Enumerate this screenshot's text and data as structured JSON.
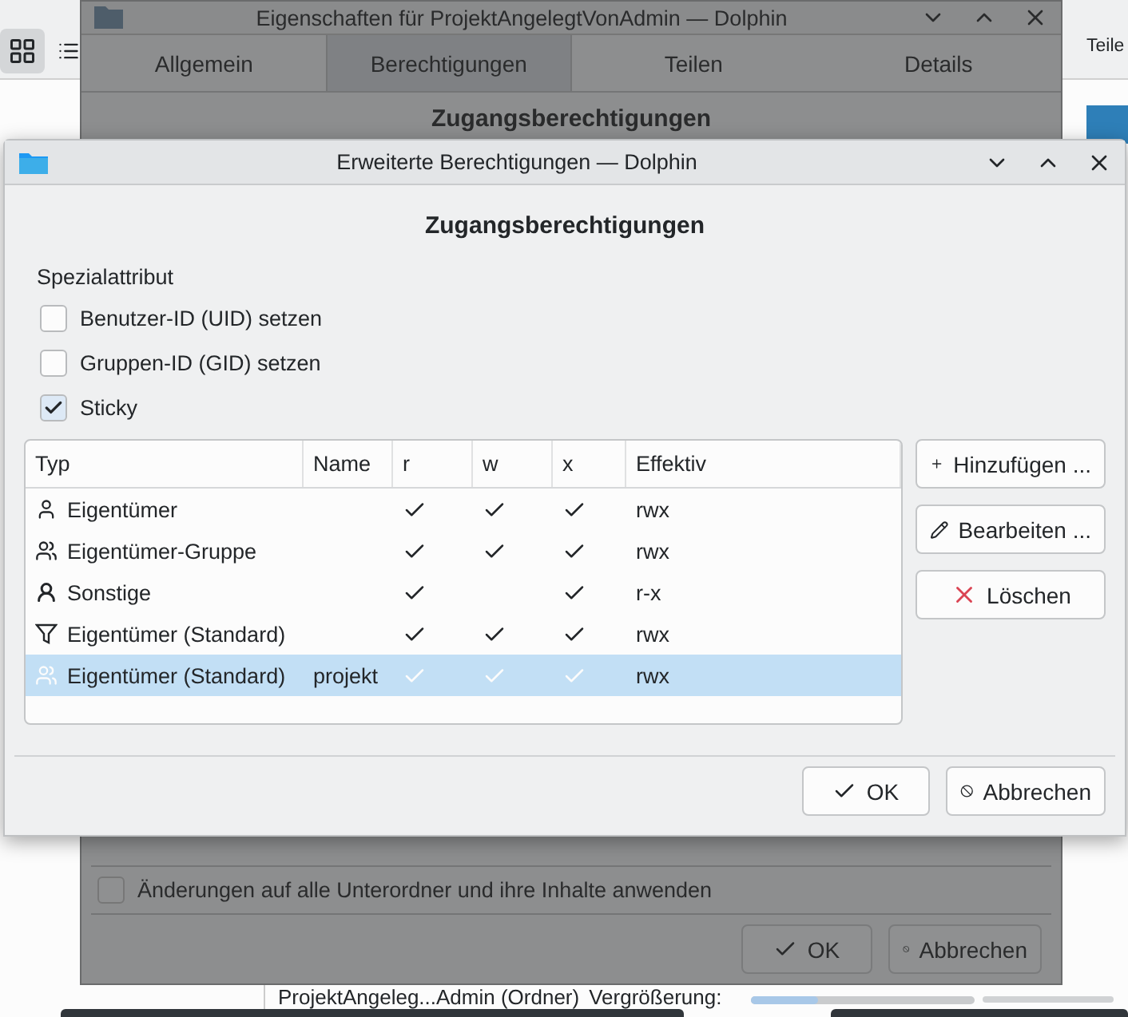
{
  "background_app": {
    "toolbar_label": "Teile",
    "status_text": "ProjektAngeleg...Admin (Ordner)",
    "zoom_label": "Vergrößerung:",
    "zoom_slider": {
      "level": 0.3
    }
  },
  "properties_window": {
    "title": "Eigenschaften für ProjektAngelegtVonAdmin — Dolphin",
    "tabs": [
      {
        "label": "Allgemein",
        "selected": false
      },
      {
        "label": "Berechtigungen",
        "selected": true
      },
      {
        "label": "Teilen",
        "selected": false
      },
      {
        "label": "Details",
        "selected": false
      }
    ],
    "heading": "Zugangsberechtigungen",
    "recursive": {
      "label": "Änderungen auf alle Unterordner und ihre Inhalte anwenden",
      "checked": false
    },
    "buttons": [
      {
        "label": "OK",
        "kind": "ok"
      },
      {
        "label": "Abbrechen",
        "kind": "cancel"
      }
    ]
  },
  "dialog": {
    "title": "Erweiterte Berechtigungen — Dolphin",
    "heading": "Zugangsberechtigungen",
    "section_label": "Spezialattribut",
    "attributes": [
      {
        "label": "Benutzer-ID (UID) setzen",
        "checked": false
      },
      {
        "label": "Gruppen-ID (GID) setzen",
        "checked": false
      },
      {
        "label": "Sticky",
        "checked": true
      }
    ],
    "table": {
      "columns": [
        "Typ",
        "Name",
        "r",
        "w",
        "x",
        "Effektiv"
      ],
      "rows": [
        {
          "kind": "owner",
          "type": "Eigentümer",
          "r": true,
          "w": true,
          "x": true,
          "effective": "rwx",
          "selected": false
        },
        {
          "kind": "group",
          "type": "Eigentümer-Gruppe",
          "r": true,
          "w": true,
          "x": true,
          "effective": "rwx",
          "selected": false
        },
        {
          "kind": "others",
          "type": "Sonstige",
          "r": true,
          "w": false,
          "x": true,
          "effective": "r-x",
          "selected": false
        },
        {
          "kind": "mask",
          "type": "Eigentümer (Standard)",
          "r": true,
          "w": true,
          "x": true,
          "effective": "rwx",
          "selected": false
        },
        {
          "kind": "named",
          "type": "Eigentümer (Standard)",
          "name": "projekt",
          "r": true,
          "w": true,
          "x": true,
          "effective": "rwx",
          "selected": true
        }
      ]
    },
    "side_buttons": [
      {
        "label": "Hinzufügen ...",
        "kind": "add"
      },
      {
        "label": "Bearbeiten ...",
        "kind": "edit"
      },
      {
        "label": "Löschen",
        "kind": "delete"
      }
    ],
    "buttons": [
      {
        "label": "OK",
        "kind": "ok"
      },
      {
        "label": "Abbrechen",
        "kind": "cancel"
      }
    ]
  }
}
